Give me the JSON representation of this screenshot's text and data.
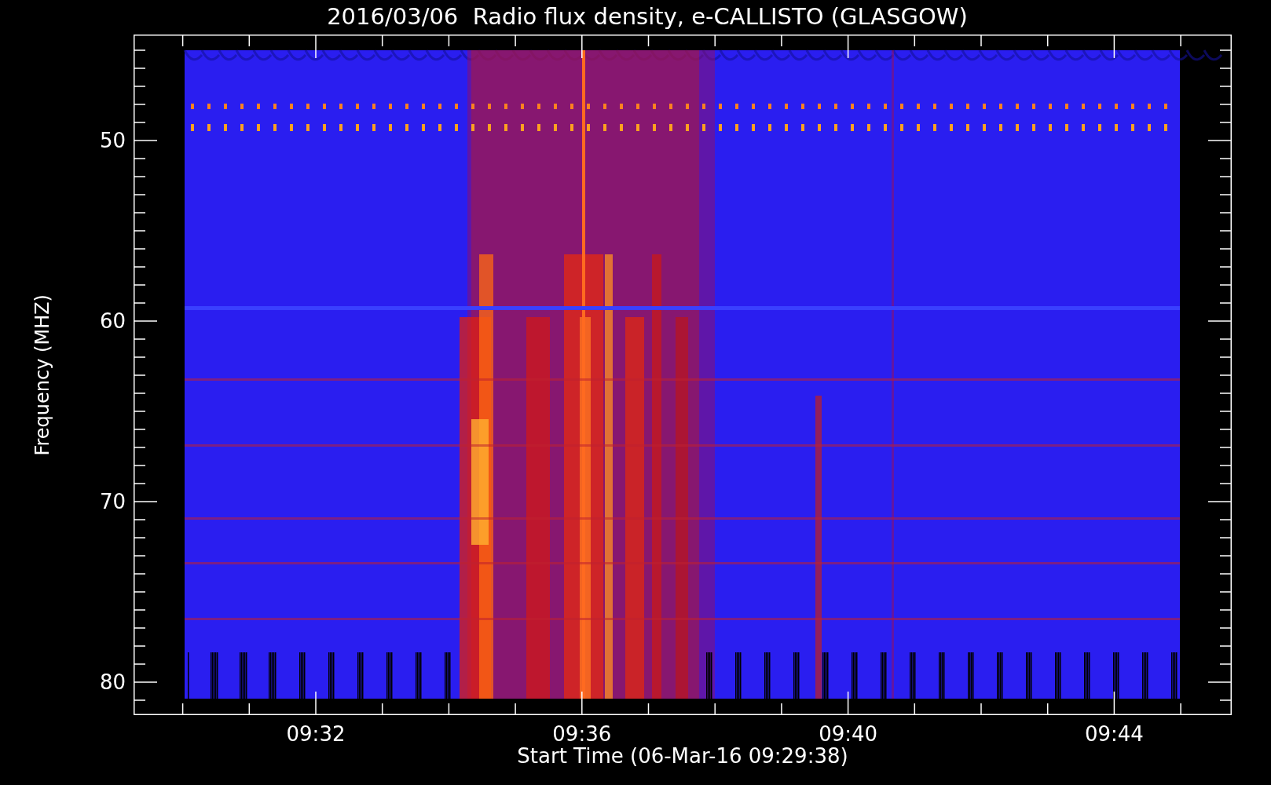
{
  "title": "2016/03/06  Radio flux density, e-CALLISTO (GLASGOW)",
  "y_axis": {
    "label": "Frequency (MHZ)",
    "ticks": [
      "50",
      "60",
      "70",
      "80"
    ]
  },
  "x_axis": {
    "label": "Start Time (06-Mar-16 09:29:38)",
    "ticks": [
      "09:32",
      "09:36",
      "09:40",
      "09:44"
    ]
  }
}
